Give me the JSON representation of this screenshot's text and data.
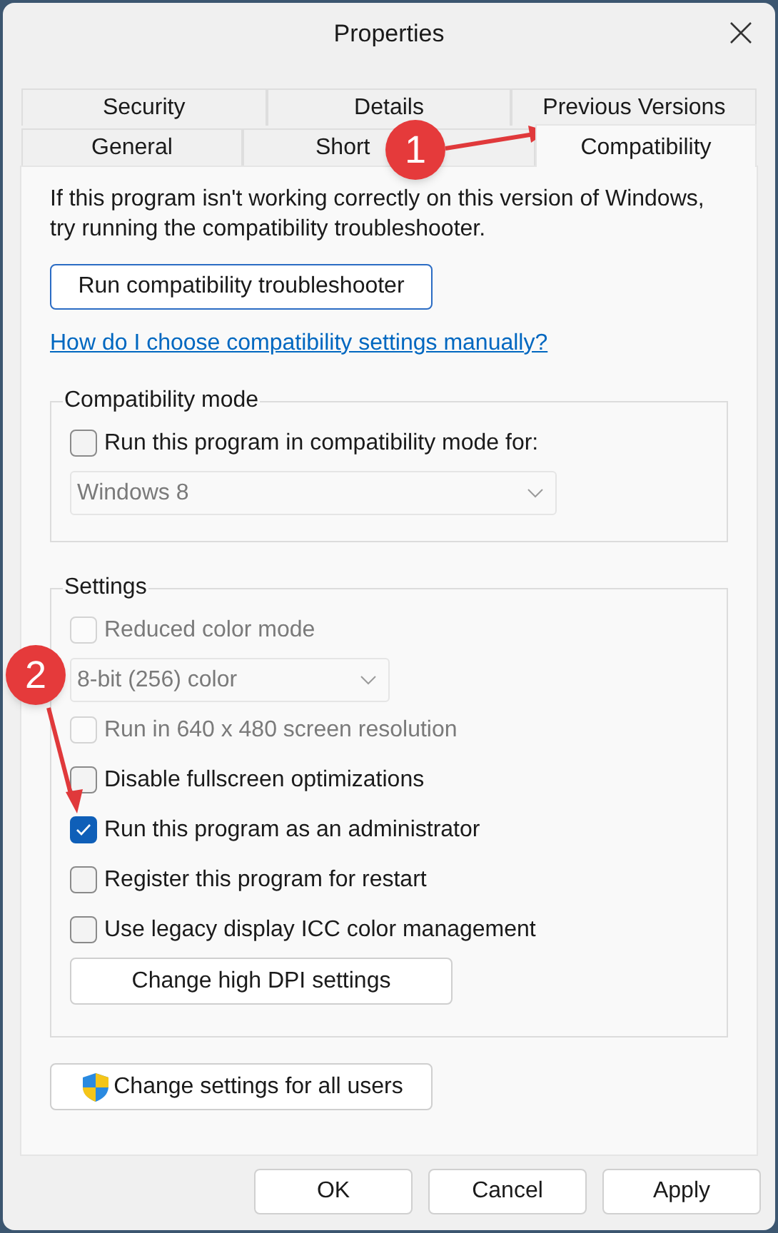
{
  "window": {
    "title": "Properties"
  },
  "tab_rows": [
    [
      {
        "label": "Security",
        "selected": false
      },
      {
        "label": "Details",
        "selected": false
      },
      {
        "label": "Previous Versions",
        "selected": false
      }
    ],
    [
      {
        "label": "General",
        "selected": false
      },
      {
        "label": "Short",
        "selected": false
      },
      {
        "label": "Compatibility",
        "selected": true
      }
    ]
  ],
  "intro": "If this program isn't working correctly on this version of Windows, try running the compatibility troubleshooter.",
  "troubleshooter_button": "Run compatibility troubleshooter",
  "help_link": "How do I choose compatibility settings manually?",
  "compatibility_mode": {
    "title": "Compatibility mode",
    "items": [
      {
        "kind": "checkbox",
        "label": "Run this program in compatibility mode for:",
        "checked": false,
        "disabled": false
      },
      {
        "kind": "dropdown",
        "value": "Windows 8",
        "disabled": true
      }
    ]
  },
  "settings": {
    "title": "Settings",
    "items": [
      {
        "kind": "checkbox",
        "label": "Reduced color mode",
        "checked": false,
        "disabled": true
      },
      {
        "kind": "dropdown",
        "value": "8-bit (256) color",
        "disabled": true
      },
      {
        "kind": "checkbox",
        "label": "Run in 640 x 480 screen resolution",
        "checked": false,
        "disabled": true
      },
      {
        "kind": "checkbox",
        "label": "Disable fullscreen optimizations",
        "checked": false,
        "disabled": false
      },
      {
        "kind": "checkbox",
        "label": "Run this program as an administrator",
        "checked": true,
        "disabled": false
      },
      {
        "kind": "checkbox",
        "label": "Register this program for restart",
        "checked": false,
        "disabled": false
      },
      {
        "kind": "checkbox",
        "label": "Use legacy display ICC color management",
        "checked": false,
        "disabled": false
      },
      {
        "kind": "button",
        "label": "Change high DPI settings"
      }
    ]
  },
  "all_users_button": "Change settings for all users",
  "buttons": [
    "OK",
    "Cancel",
    "Apply"
  ],
  "annotations": [
    {
      "label": "1"
    },
    {
      "label": "2"
    }
  ]
}
